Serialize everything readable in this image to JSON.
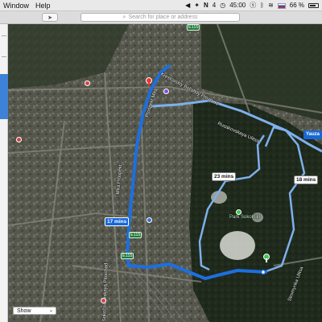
{
  "menubar": {
    "items": [
      "Window",
      "Help"
    ],
    "status": {
      "menu_n": "N",
      "count": "4",
      "clock": "45:00",
      "battery": "66 %"
    }
  },
  "toolbar": {
    "search_placeholder": "Search for place or address"
  },
  "map": {
    "route_times": {
      "primary": "17 mins",
      "alt_west": "23 mins",
      "alt_east": "18 mins"
    },
    "shields": [
      "E115",
      "E115",
      "E115"
    ],
    "park_label": "Park Sokolniki",
    "place_badge": "Yauza",
    "street_labels": [
      "Krestovskiy Bol'shoy Prospekt",
      "Prospekt Mira",
      "Mira Prospekt",
      "Rusakovskaya Ulitsa",
      "Stromynka Ulitsa",
      "Sokol'nicheskaya Ploschad"
    ],
    "colors": {
      "route_main": "#1d6fe0",
      "route_alt": "#7eb0ec",
      "park": "#1f2d1d"
    }
  },
  "bottom": {
    "show_label": "Show"
  }
}
